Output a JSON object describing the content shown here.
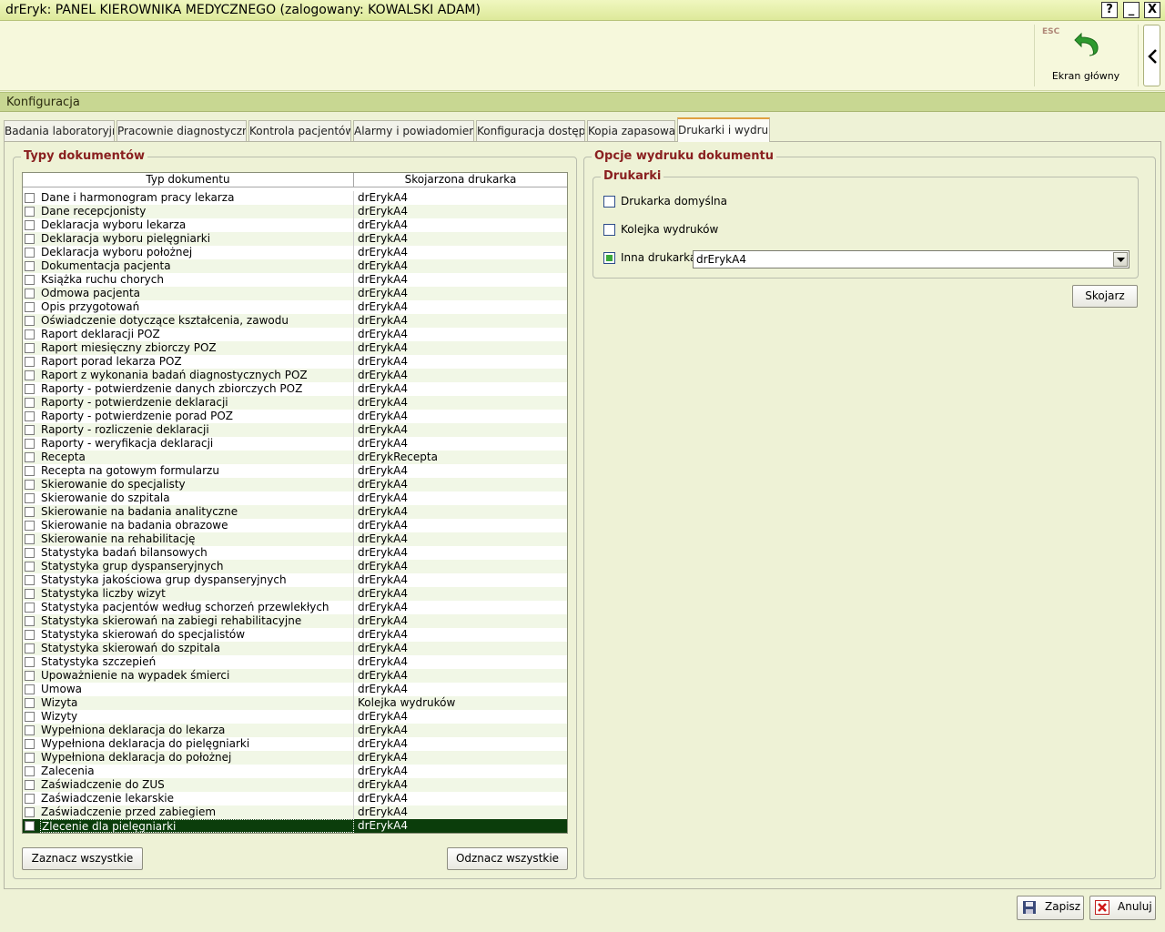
{
  "window": {
    "title": "drEryk: PANEL KIEROWNIKA MEDYCZNEGO (zalogowany: KOWALSKI ADAM)",
    "help_glyph": "?",
    "minimize_glyph": "_",
    "close_glyph": "X"
  },
  "toolbar": {
    "esc_label": "ESC",
    "home_label": "Ekran główny",
    "home_icon": "undo-arrow-icon",
    "collapse_icon": "chevron-left-icon"
  },
  "section": {
    "title": "Konfiguracja"
  },
  "tabs": [
    {
      "label": "Badania laboratoryjne"
    },
    {
      "label": "Pracownie diagnostyczne"
    },
    {
      "label": "Kontrola pacjentów"
    },
    {
      "label": "Alarmy i powiadomienia"
    },
    {
      "label": "Konfiguracja dostępu"
    },
    {
      "label": "Kopia zapasowa"
    },
    {
      "label": "Drukarki i wydruki",
      "active": true
    }
  ],
  "doc_types": {
    "legend": "Typy dokumentów",
    "col_type": "Typ dokumentu",
    "col_printer": "Skojarzona drukarka",
    "rows": [
      {
        "type": "Dane i harmonogram pracy lekarza",
        "printer": "drErykA4"
      },
      {
        "type": "Dane recepcjonisty",
        "printer": "drErykA4"
      },
      {
        "type": "Deklaracja wyboru lekarza",
        "printer": "drErykA4"
      },
      {
        "type": "Deklaracja wyboru pielęgniarki",
        "printer": "drErykA4"
      },
      {
        "type": "Deklaracja wyboru położnej",
        "printer": "drErykA4"
      },
      {
        "type": "Dokumentacja pacjenta",
        "printer": "drErykA4"
      },
      {
        "type": "Książka ruchu chorych",
        "printer": "drErykA4"
      },
      {
        "type": "Odmowa pacjenta",
        "printer": "drErykA4"
      },
      {
        "type": "Opis przygotowań",
        "printer": "drErykA4"
      },
      {
        "type": "Oświadczenie dotyczące kształcenia, zawodu",
        "printer": "drErykA4"
      },
      {
        "type": "Raport deklaracji POZ",
        "printer": "drErykA4"
      },
      {
        "type": "Raport miesięczny zbiorczy POZ",
        "printer": "drErykA4"
      },
      {
        "type": "Raport porad lekarza POZ",
        "printer": "drErykA4"
      },
      {
        "type": "Raport z wykonania badań diagnostycznych POZ",
        "printer": "drErykA4"
      },
      {
        "type": "Raporty - potwierdzenie danych zbiorczych POZ",
        "printer": "drErykA4"
      },
      {
        "type": "Raporty - potwierdzenie deklaracji",
        "printer": "drErykA4"
      },
      {
        "type": "Raporty - potwierdzenie porad POZ",
        "printer": "drErykA4"
      },
      {
        "type": "Raporty - rozliczenie deklaracji",
        "printer": "drErykA4"
      },
      {
        "type": "Raporty - weryfikacja deklaracji",
        "printer": "drErykA4"
      },
      {
        "type": "Recepta",
        "printer": "drErykRecepta"
      },
      {
        "type": "Recepta na gotowym formularzu",
        "printer": "drErykA4"
      },
      {
        "type": "Skierowanie do specjalisty",
        "printer": "drErykA4"
      },
      {
        "type": "Skierowanie do szpitala",
        "printer": "drErykA4"
      },
      {
        "type": "Skierowanie na badania analityczne",
        "printer": "drErykA4"
      },
      {
        "type": "Skierowanie na badania obrazowe",
        "printer": "drErykA4"
      },
      {
        "type": "Skierowanie na rehabilitację",
        "printer": "drErykA4"
      },
      {
        "type": "Statystyka badań bilansowych",
        "printer": "drErykA4"
      },
      {
        "type": "Statystyka grup dyspanseryjnych",
        "printer": "drErykA4"
      },
      {
        "type": "Statystyka jakościowa grup dyspanseryjnych",
        "printer": "drErykA4"
      },
      {
        "type": "Statystyka liczby wizyt",
        "printer": "drErykA4"
      },
      {
        "type": "Statystyka pacjentów według schorzeń przewlekłych",
        "printer": "drErykA4"
      },
      {
        "type": "Statystyka skierowań na zabiegi rehabilitacyjne",
        "printer": "drErykA4"
      },
      {
        "type": "Statystyka skierowań do specjalistów",
        "printer": "drErykA4"
      },
      {
        "type": "Statystyka skierowań do szpitala",
        "printer": "drErykA4"
      },
      {
        "type": "Statystyka szczepień",
        "printer": "drErykA4"
      },
      {
        "type": "Upoważnienie na wypadek śmierci",
        "printer": "drErykA4"
      },
      {
        "type": "Umowa",
        "printer": "drErykA4"
      },
      {
        "type": "Wizyta",
        "printer": "Kolejka wydruków"
      },
      {
        "type": "Wizyty",
        "printer": "drErykA4"
      },
      {
        "type": "Wypełniona deklaracja do lekarza",
        "printer": "drErykA4"
      },
      {
        "type": "Wypełniona deklaracja do pielęgniarki",
        "printer": "drErykA4"
      },
      {
        "type": "Wypełniona deklaracja do położnej",
        "printer": "drErykA4"
      },
      {
        "type": "Zalecenia",
        "printer": "drErykA4"
      },
      {
        "type": "Zaświadczenie do ZUS",
        "printer": "drErykA4"
      },
      {
        "type": "Zaświadczenie lekarskie",
        "printer": "drErykA4"
      },
      {
        "type": "Zaświadczenie przed zabiegiem",
        "printer": "drErykA4"
      },
      {
        "type": "Zlecenie dla pielęgniarki",
        "printer": "drErykA4",
        "selected": true
      }
    ],
    "select_all_label": "Zaznacz wszystkie",
    "deselect_all_label": "Odznacz wszystkie"
  },
  "print_options": {
    "legend": "Opcje wydruku dokumentu",
    "printers_legend": "Drukarki",
    "opt_default": {
      "label": "Drukarka domyślna",
      "checked": false
    },
    "opt_queue": {
      "label": "Kolejka wydruków",
      "checked": false
    },
    "opt_other": {
      "label": "Inna drukarka",
      "checked": true
    },
    "other_printer_value": "drErykA4",
    "associate_label": "Skojarz"
  },
  "footer": {
    "save_label": "Zapisz",
    "save_icon": "floppy-disk-icon",
    "cancel_label": "Anuluj",
    "cancel_icon": "red-x-icon"
  },
  "colors": {
    "accent_green": "#c8d792",
    "selected_row": "#0b3d0b",
    "legend_red": "#8a2020"
  }
}
